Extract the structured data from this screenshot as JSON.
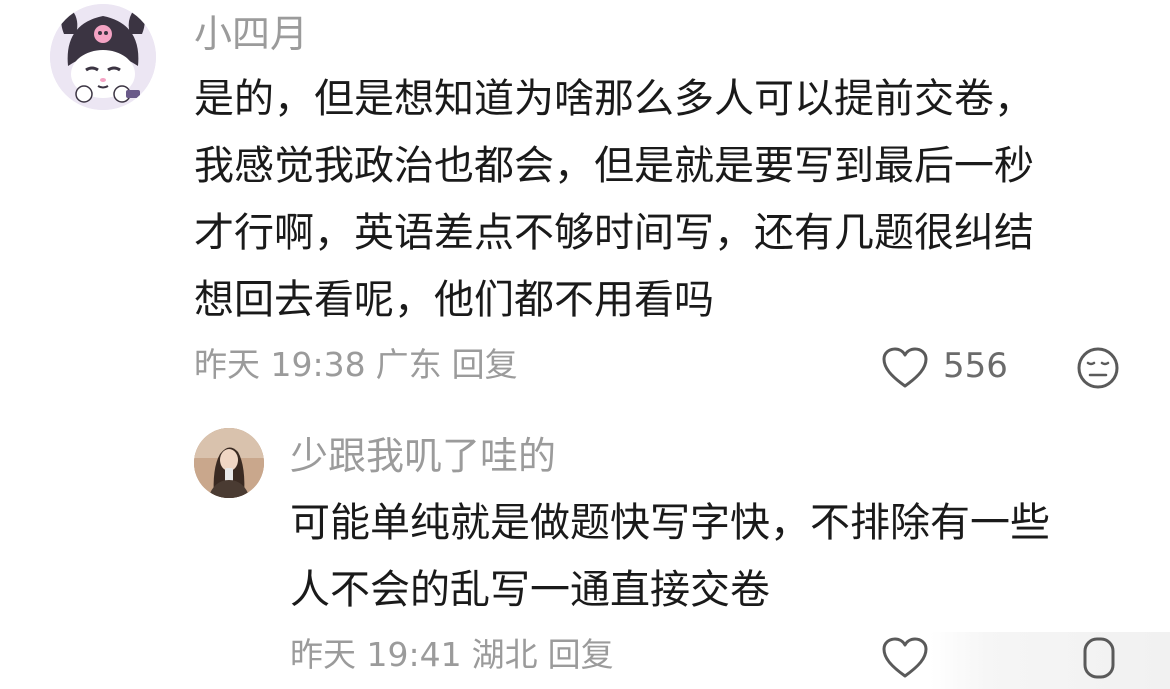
{
  "comment1": {
    "username": "小四月",
    "lines": [
      "是的，但是想知道为啥那么多人可以提前交卷，",
      "我感觉我政治也都会，但是就是要写到最后一秒",
      "才行啊，英语差点不够时间写，还有几题很纠结",
      "想回去看呢，他们都不用看吗"
    ],
    "time": "昨天 19:38",
    "location": "广东",
    "reply_label": "回复",
    "likes": "556"
  },
  "reply1": {
    "username": "少跟我叽了哇的",
    "lines": [
      "可能单纯就是做题快写字快，不排除有一些",
      "人不会的乱写一通直接交卷"
    ],
    "time": "昨天 19:41",
    "location": "湖北",
    "reply_label": "回复"
  },
  "colors": {
    "meta_gray": "#9b9b9b",
    "text": "#1a1a1a",
    "icon_gray": "#5a5a5a"
  },
  "icons": [
    "heart-icon",
    "neutral-face-icon",
    "kuromi-avatar",
    "user-photo-avatar"
  ]
}
